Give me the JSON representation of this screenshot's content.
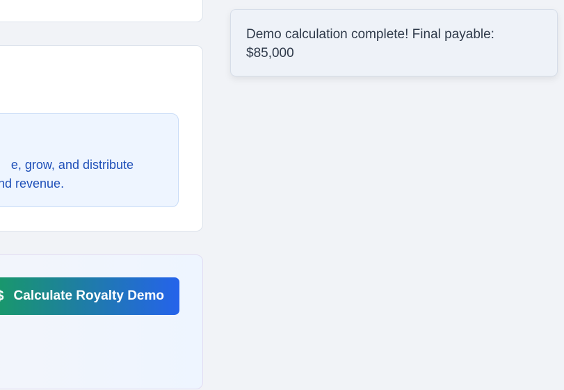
{
  "info": {
    "line1": "e, grow, and distribute",
    "line2": "nd revenue."
  },
  "actions": {
    "calculate_icon": "$",
    "calculate_label": "Calculate Royalty Demo"
  },
  "toast": {
    "message": "Demo calculation complete! Final payable: $85,000"
  },
  "colors": {
    "accent_green": "#17a05a",
    "accent_blue": "#2563eb",
    "info_text": "#1e4fb8"
  }
}
